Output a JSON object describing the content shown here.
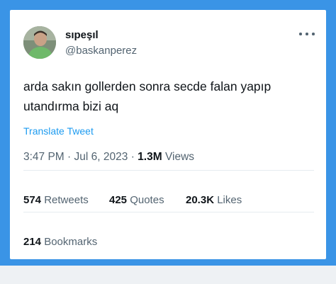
{
  "user": {
    "display_name": "sıpeşıl",
    "handle": "@baskanperez"
  },
  "tweet": {
    "text_line1": "arda sakın gollerden sonra secde falan yapıp",
    "text_line2": "utandırma bizi aq",
    "translate_label": "Translate Tweet",
    "time": "3:47 PM",
    "separator1": "·",
    "date": "Jul 6, 2023",
    "separator2": "·",
    "views_count": "1.3M",
    "views_label": "Views"
  },
  "stats": {
    "retweets_count": "574",
    "retweets_label": "Retweets",
    "quotes_count": "425",
    "quotes_label": "Quotes",
    "likes_count": "20.3K",
    "likes_label": "Likes",
    "bookmarks_count": "214",
    "bookmarks_label": "Bookmarks"
  },
  "colors": {
    "frame": "#3a94e6",
    "link": "#1d9bf0",
    "secondary_text": "#536471",
    "primary_text": "#0f1419"
  },
  "icons": {
    "more": "more-icon"
  }
}
